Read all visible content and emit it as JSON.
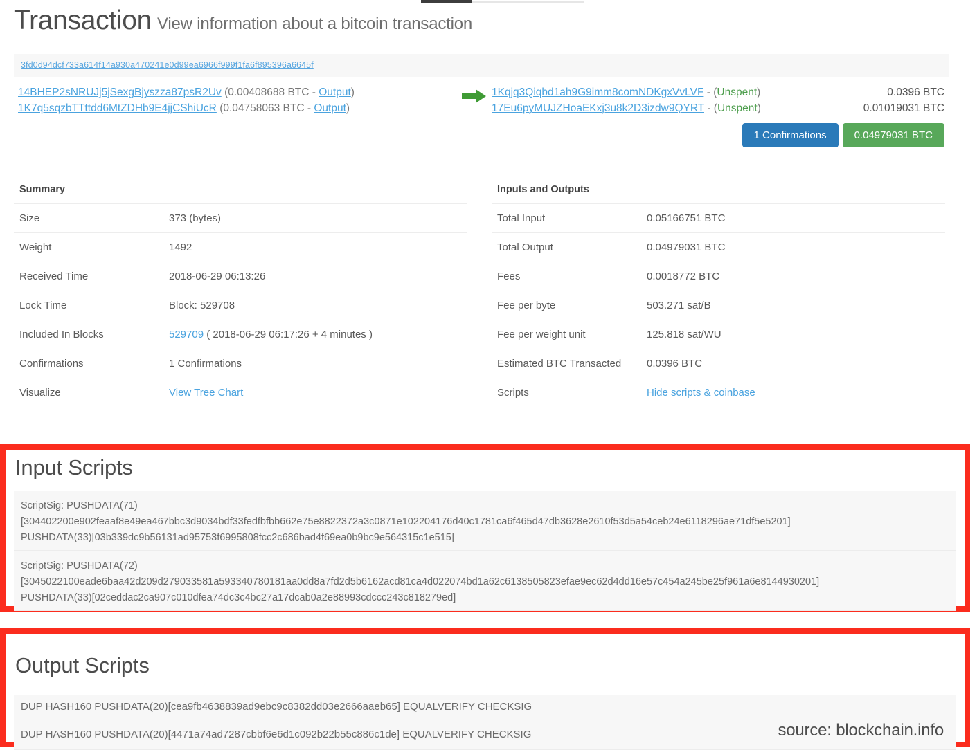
{
  "page": {
    "title": "Transaction",
    "subtitle": "View information about a bitcoin transaction",
    "hash": "3fd0d94dcf733a614f14a930a470241e0d99ea6966f999f1fa6f895396a6645f",
    "source_note": "source: blockchain.info",
    "accent_blue": "#4aa3df",
    "badge_blue": "#2a7ab9",
    "badge_green": "#58a85a",
    "highlight_red": "#fb2c1e",
    "arrow_green": "#3f9b35"
  },
  "io_band": {
    "arrow_icon": "arrow-right-icon",
    "inputs": [
      {
        "address": "14BHEP2sNRUJj5jSexgBjyszza87psR2Uv",
        "open_paren": "(",
        "amount": "0.00408688 BTC",
        "dash": "-",
        "link_label": "Output",
        "close_paren": ")"
      },
      {
        "address": "1K7q5sqzbTTttdd6MtZDHb9E4jjCShiUcR",
        "open_paren": "(",
        "amount": "0.04758063 BTC",
        "dash": "-",
        "link_label": "Output",
        "close_paren": ")"
      }
    ],
    "outputs": [
      {
        "address": "1Kqjq3Qiqbd1ah9G9imm8comNDKgxVvLVF",
        "dash": "-",
        "open_paren": "(",
        "status": "Unspent",
        "close_paren": ")",
        "amount": "0.0396 BTC"
      },
      {
        "address": "17Eu6pyMUJZHoaEKxj3u8k2D3izdw9QYRT",
        "dash": "-",
        "open_paren": "(",
        "status": "Unspent",
        "close_paren": ")",
        "amount": "0.01019031 BTC"
      }
    ],
    "badges": {
      "confirmations": "1 Confirmations",
      "total": "0.04979031 BTC"
    }
  },
  "summary": {
    "header": "Summary",
    "rows": [
      {
        "key": "Size",
        "value": "373 (bytes)"
      },
      {
        "key": "Weight",
        "value": "1492"
      },
      {
        "key": "Received Time",
        "value": "2018-06-29 06:13:26"
      },
      {
        "key": "Lock Time",
        "value": "Block: 529708"
      },
      {
        "key": "Included In Blocks",
        "value": "",
        "link": "529709",
        "suffix": "( 2018-06-29 06:17:26 + 4 minutes )"
      },
      {
        "key": "Confirmations",
        "value": "1 Confirmations"
      },
      {
        "key": "Visualize",
        "value": "",
        "link": "View Tree Chart"
      }
    ]
  },
  "inputs_outputs": {
    "header": "Inputs and Outputs",
    "rows": [
      {
        "key": "Total Input",
        "value": "0.05166751 BTC"
      },
      {
        "key": "Total Output",
        "value": "0.04979031 BTC"
      },
      {
        "key": "Fees",
        "value": "0.0018772 BTC"
      },
      {
        "key": "Fee per byte",
        "value": "503.271 sat/B"
      },
      {
        "key": "Fee per weight unit",
        "value": "125.818 sat/WU"
      },
      {
        "key": "Estimated BTC Transacted",
        "value": "0.0396 BTC"
      },
      {
        "key": "Scripts",
        "value": "",
        "link": "Hide scripts & coinbase"
      }
    ]
  },
  "input_scripts": {
    "title": "Input Scripts",
    "blocks": [
      {
        "line1": "ScriptSig: PUSHDATA(71)",
        "line2": "[304402200e902feaaf8e49ea467bbc3d9034bdf33fedfbfbb662e75e8822372a3c0871e102204176d40c1781ca6f465d47db3628e2610f53d5a54ceb24e6118296ae71df5e5201]",
        "line3": "PUSHDATA(33)[03b339dc9b56131ad95753f6995808fcc2c686bad4f69ea0b9bc9e564315c1e515]"
      },
      {
        "line1": "ScriptSig: PUSHDATA(72)",
        "line2": "[3045022100eade6baa42d209d279033581a593340780181aa0dd8a7fd2d5b6162acd81ca4d022074bd1a62c6138505823efae9ec62d4dd16e57c454a245be25f961a6e8144930201]",
        "line3": "PUSHDATA(33)[02ceddac2ca907c010dfea74dc3c4bc27a17dcab0a2e88993cdccc243c818279ed]"
      }
    ]
  },
  "output_scripts": {
    "title": "Output Scripts",
    "rows": [
      "DUP HASH160 PUSHDATA(20)[cea9fb4638839ad9ebc9c8382dd03e2666aaeb65] EQUALVERIFY CHECKSIG",
      "DUP HASH160 PUSHDATA(20)[4471a74ad7287cbbf6e6d1c092b22b55c886c1de] EQUALVERIFY CHECKSIG"
    ]
  }
}
